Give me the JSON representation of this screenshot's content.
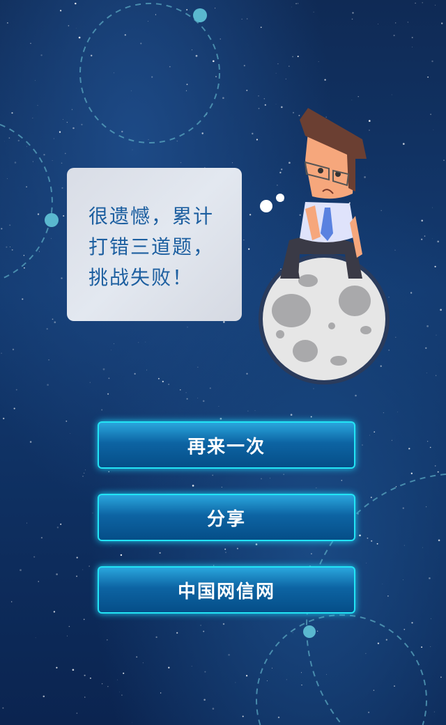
{
  "message": {
    "lines": [
      "很遗憾，累计",
      "打错三道题，",
      "挑战失败！"
    ]
  },
  "buttons": {
    "retry": "再来一次",
    "share": "分享",
    "site": "中国网信网"
  },
  "colors": {
    "accent": "#22e4f5",
    "message_text": "#1d5fa0",
    "button_top": "#2aa6dd",
    "button_bottom": "#054e88"
  }
}
